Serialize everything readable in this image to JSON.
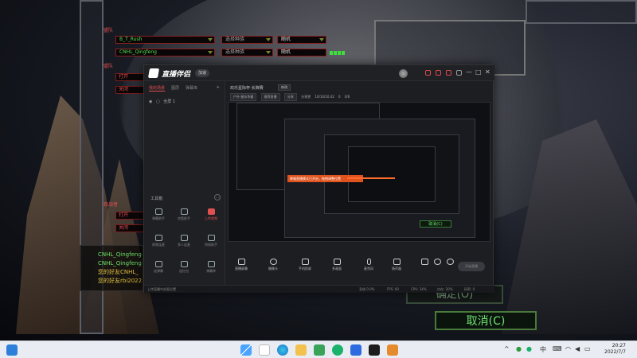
{
  "game_lobby": {
    "team_a_label": "盟队",
    "player1_name": "B_T_Rush",
    "player2_name": "CNHL_Qingfeng",
    "race_placeholder_1": "选择种族",
    "race_placeholder_2": "选择种族",
    "race_value_1": "随机",
    "race_value_2": "随机",
    "team_b_label": "盟队",
    "open_label": "打开",
    "close_label": "关闭",
    "observer_label": "观战者",
    "observer_open": "打开",
    "observer_close": "关闭",
    "chat": [
      "CNHL_Qingfeng",
      "CNHL_Qingfeng",
      "您的好友CNHL_",
      "您的好友rbi2022"
    ],
    "status_btn": "取消(C)",
    "confirm_btn": "确定(O)",
    "cancel_btn": "取消(C)"
  },
  "app": {
    "name": "直播伴侣",
    "badge": "加速",
    "tabs": [
      "我的场景",
      "图层",
      "弹幕库"
    ],
    "scene_item": "全屏 1",
    "tools_header": "工具箱",
    "tools": [
      "弹幕助手",
      "房管助手",
      "上传视频",
      "视频连麦",
      "多人连麦",
      "特效助手",
      "送弹幕",
      "送红包",
      "弹幕库",
      "开播",
      "",
      ""
    ],
    "room_title": "欢乐星际杯·长牌赛",
    "modify": "修改",
    "subbar": [
      "户外·星际争霸",
      "推荐直播",
      "分享",
      "分享赏",
      "10/10/10.42",
      "0",
      "0/6"
    ],
    "toast": "降噪直播模式已开启，拖拽调整位置",
    "toolbar": [
      "直播屏幕",
      "摄像头",
      "手机投屏",
      "多画面",
      "麦克风",
      "扬声器"
    ],
    "start_label": "开始直播",
    "status_left": "上传直播中封面位置",
    "status_items": [
      "丢帧 0.0%",
      "FPS: 60",
      "CPU: 34%",
      "内存: 20%",
      "码率: 0"
    ]
  },
  "taskbar": {
    "time": "20:27",
    "date": "2022/7/7",
    "lang": "中",
    "chevron": "^"
  }
}
